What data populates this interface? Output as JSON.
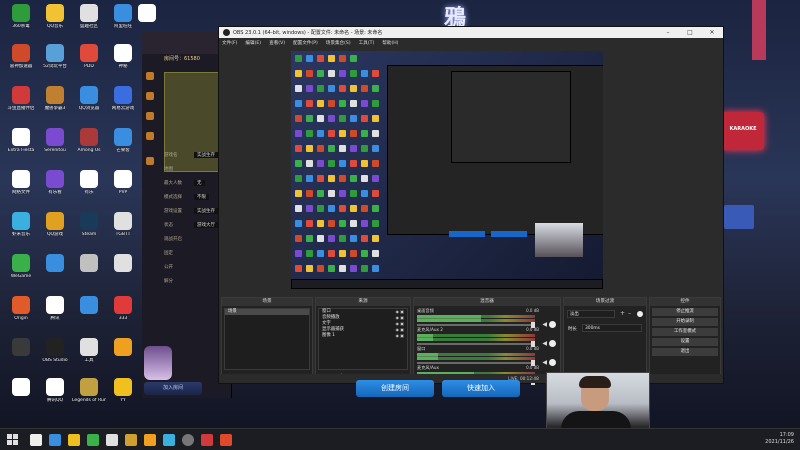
{
  "desktop": {
    "neon_sign_top": "鴉",
    "neon_sign_right": "KARAOKE",
    "icons": [
      {
        "label": "360杀毒",
        "color": "#2e9c3a"
      },
      {
        "label": "QQ音乐",
        "color": "#f1c232"
      },
      {
        "label": "盛趣社区",
        "color": "#e0e0e0"
      },
      {
        "label": "阿里旺旺",
        "color": "#3a8ee0"
      },
      {
        "label": "",
        "color": "#ffffff"
      },
      {
        "label": "雷神加速器",
        "color": "#d04a2a"
      },
      {
        "label": "52试玩平台",
        "color": "#5aa0d8"
      },
      {
        "label": "PDD",
        "color": "#e04a3a"
      },
      {
        "label": "神秘",
        "color": "#ffffff"
      },
      {
        "label": "斗鱼直播伴侣",
        "color": "#d03a3a"
      },
      {
        "label": "魔兽争霸3",
        "color": "#c08030"
      },
      {
        "label": "QQ浏览器",
        "color": "#3a8ee0"
      },
      {
        "label": "网易云游戏",
        "color": "#3a6ee0"
      },
      {
        "label": "Extra Fiesta",
        "color": "#ffffff"
      },
      {
        "label": "Serenitou",
        "color": "#7a4ad0"
      },
      {
        "label": "Among Us",
        "color": "#aa3a3a"
      },
      {
        "label": "芒果客",
        "color": "#3a8ee0"
      },
      {
        "label": "网络文件",
        "color": "#ffffff"
      },
      {
        "label": "有乐看",
        "color": "#7a4ad0"
      },
      {
        "label": "有乐",
        "color": "#ffffff"
      },
      {
        "label": "PVP",
        "color": "#ffffff"
      },
      {
        "label": "虾米音乐",
        "color": "#3ab0e0"
      },
      {
        "label": "QQ游戏",
        "color": "#e0a020"
      },
      {
        "label": "Steam",
        "color": "#1a3a5a"
      },
      {
        "label": "TGBTT",
        "color": "#e0e0e0"
      },
      {
        "label": "WeGame",
        "color": "#3ab04a"
      },
      {
        "label": "",
        "color": "#3a8ee0"
      },
      {
        "label": "",
        "color": "#c0c0c0"
      },
      {
        "label": "",
        "color": "#e0e0e0"
      },
      {
        "label": "Origin",
        "color": "#e05a2a"
      },
      {
        "label": "腾讯",
        "color": "#ffffff"
      },
      {
        "label": "",
        "color": "#3a8ee0"
      },
      {
        "label": "333",
        "color": "#e03a3a"
      },
      {
        "label": "",
        "color": "#3a3a3a"
      },
      {
        "label": "OBS Studio",
        "color": "#222222"
      },
      {
        "label": "工具",
        "color": "#e0e0e0"
      },
      {
        "label": "",
        "color": "#f0a020"
      },
      {
        "label": "",
        "color": "#ffffff"
      },
      {
        "label": "腾讯QQ",
        "color": "#ffffff"
      },
      {
        "label": "Legends of Runeterra",
        "color": "#c0a040"
      },
      {
        "label": "YY",
        "color": "#f0c020"
      }
    ]
  },
  "game_window": {
    "room_label": "房间号：61580",
    "rows": [
      {
        "k": "游戏名",
        "v": "实战生存"
      },
      {
        "k": "地图",
        "v": ""
      },
      {
        "k": "最大人数",
        "v": "无"
      },
      {
        "k": "模式选择",
        "v": "不限"
      },
      {
        "k": "游戏设置",
        "v": "实战生存"
      },
      {
        "k": "状态",
        "v": "游戏大厅"
      },
      {
        "k": "观战开启",
        "v": ""
      },
      {
        "k": "固定",
        "v": ""
      },
      {
        "k": "公开",
        "v": ""
      },
      {
        "k": "解分",
        "v": ""
      }
    ],
    "join_room_label": "加入房间",
    "create_room_label": "创建房间",
    "quick_join_label": "快速加入"
  },
  "obs": {
    "title": "OBS 23.0.1 (64-bit, windows) - 配置文件: 未命名 - 场景: 未命名",
    "menu": [
      "文件(F)",
      "编辑(E)",
      "查看(V)",
      "配置文件(P)",
      "场景集合(S)",
      "工具(T)",
      "帮助(H)"
    ],
    "docks": {
      "scenes": {
        "title": "场景",
        "items": [
          "场景"
        ]
      },
      "sources": {
        "title": "来源",
        "items": [
          "窗口",
          "音频播放",
          "文字",
          "显示器捕获",
          "图像 1"
        ]
      },
      "mixer": {
        "title": "混音器",
        "channels": [
          {
            "name": "桌面音频",
            "db": "0.0 dB",
            "level": 0.62
          },
          {
            "name": "麦克风/Aux 2",
            "db": "0.0 dB",
            "level": 0.15
          },
          {
            "name": "窗口",
            "db": "0.0 dB",
            "level": 0.2
          },
          {
            "name": "麦克风/Aux",
            "db": "0.0 dB",
            "level": 0.55
          }
        ]
      },
      "transitions": {
        "title": "场景过渡",
        "mode": "淡出",
        "duration_label": "时长",
        "duration": "300ms"
      },
      "controls": {
        "title": "控件",
        "buttons": [
          "停止推流",
          "开始录制",
          "工作室模式",
          "设置",
          "退出"
        ]
      }
    },
    "status": {
      "live": "LIVE: 00:12:48",
      "rec": "REC: 00:00:00",
      "cpu": "CPU: 12.6%",
      "fps": "30.00 fps"
    }
  },
  "taskbar": {
    "time": "17:09",
    "date": "2021/11/26"
  }
}
